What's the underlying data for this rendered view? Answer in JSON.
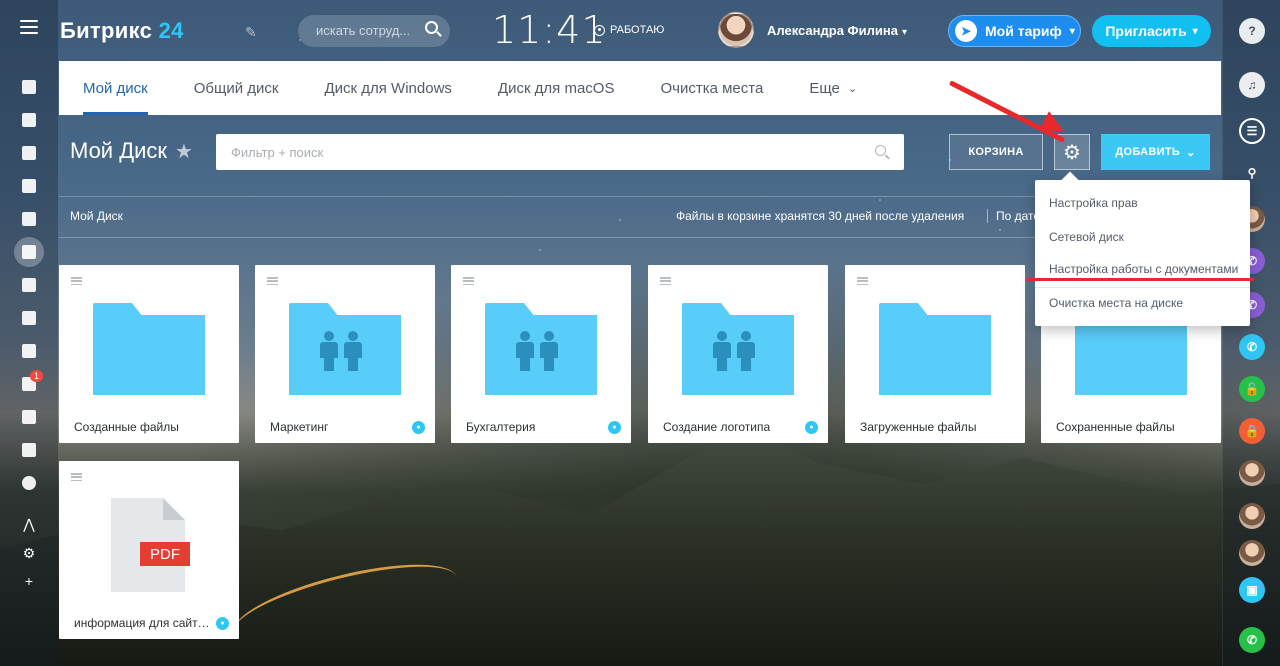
{
  "header": {
    "logo_text": "Битрикс",
    "logo_num": "24",
    "search_placeholder": "искать сотруд...",
    "clock": "11:41",
    "status": "РАБОТАЮ",
    "user_name": "Александра Филина",
    "tariff_label": "Мой тариф",
    "invite_label": "Пригласить"
  },
  "tabs": [
    {
      "label": "Мой диск"
    },
    {
      "label": "Общий диск"
    },
    {
      "label": "Диск для Windows"
    },
    {
      "label": "Диск для macOS"
    },
    {
      "label": "Очистка места"
    },
    {
      "label": "Еще"
    }
  ],
  "toolbar": {
    "page_title": "Мой Диск",
    "filter_placeholder": "Фильтр + поиск",
    "trash_label": "КОРЗИНА",
    "add_label": "ДОБАВИТЬ"
  },
  "breadcrumb": {
    "current": "Мой Диск",
    "trash_note": "Файлы в корзине хранятся 30 дней после удаления",
    "sort_label": "По дате"
  },
  "settings_menu": {
    "items": [
      {
        "label": "Настройка прав"
      },
      {
        "label": "Сетевой диск"
      },
      {
        "label": "Настройка работы с документами"
      },
      {
        "label": "Очистка места на диске"
      }
    ]
  },
  "files": [
    {
      "name": "Созданные файлы",
      "type": "folder",
      "shared": false
    },
    {
      "name": "Маркетинг",
      "type": "group-folder",
      "shared": true
    },
    {
      "name": "Бухгалтерия",
      "type": "group-folder",
      "shared": true
    },
    {
      "name": "Создание логотипа",
      "type": "group-folder",
      "shared": true
    },
    {
      "name": "Загруженные файлы",
      "type": "folder",
      "shared": false
    },
    {
      "name": "Сохраненные файлы",
      "type": "folder",
      "shared": false
    },
    {
      "name": "информация для сайта...",
      "type": "pdf",
      "badge": "PDF",
      "shared": true
    }
  ],
  "left_sidebar": {
    "tasks_badge": "1"
  },
  "colors": {
    "accent": "#2067b0",
    "add_button": "#3bc8f5",
    "invite": "#11bff0",
    "folder": "#59cdfa",
    "annotation": "#e8282b"
  }
}
